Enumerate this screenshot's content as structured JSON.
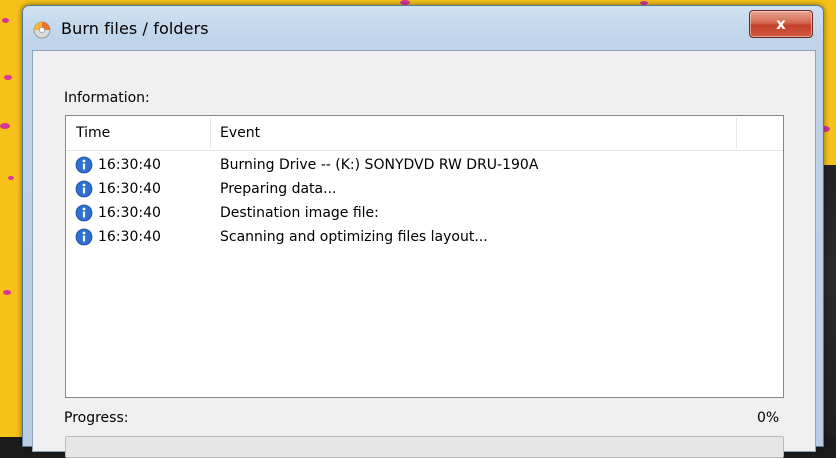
{
  "window": {
    "title": "Burn files / folders",
    "close_label": "x"
  },
  "information": {
    "label": "Information:",
    "columns": [
      "Time",
      "Event"
    ],
    "rows": [
      {
        "icon": "info-icon",
        "time": "16:30:40",
        "event": "Burning Drive -- (K:) SONYDVD RW DRU-190A"
      },
      {
        "icon": "info-icon",
        "time": "16:30:40",
        "event": "Preparing data..."
      },
      {
        "icon": "info-icon",
        "time": "16:30:40",
        "event": "Destination image file:"
      },
      {
        "icon": "info-icon",
        "time": "16:30:40",
        "event": "Scanning and optimizing files layout..."
      }
    ]
  },
  "progress": {
    "label": "Progress:",
    "percent_text": "0%",
    "value": 0
  },
  "colors": {
    "desktop_yellow": "#f6c21a",
    "desktop_dots": "#d9349a",
    "info_icon_blue": "#2f6fd1",
    "close_red": "#c4402a"
  }
}
